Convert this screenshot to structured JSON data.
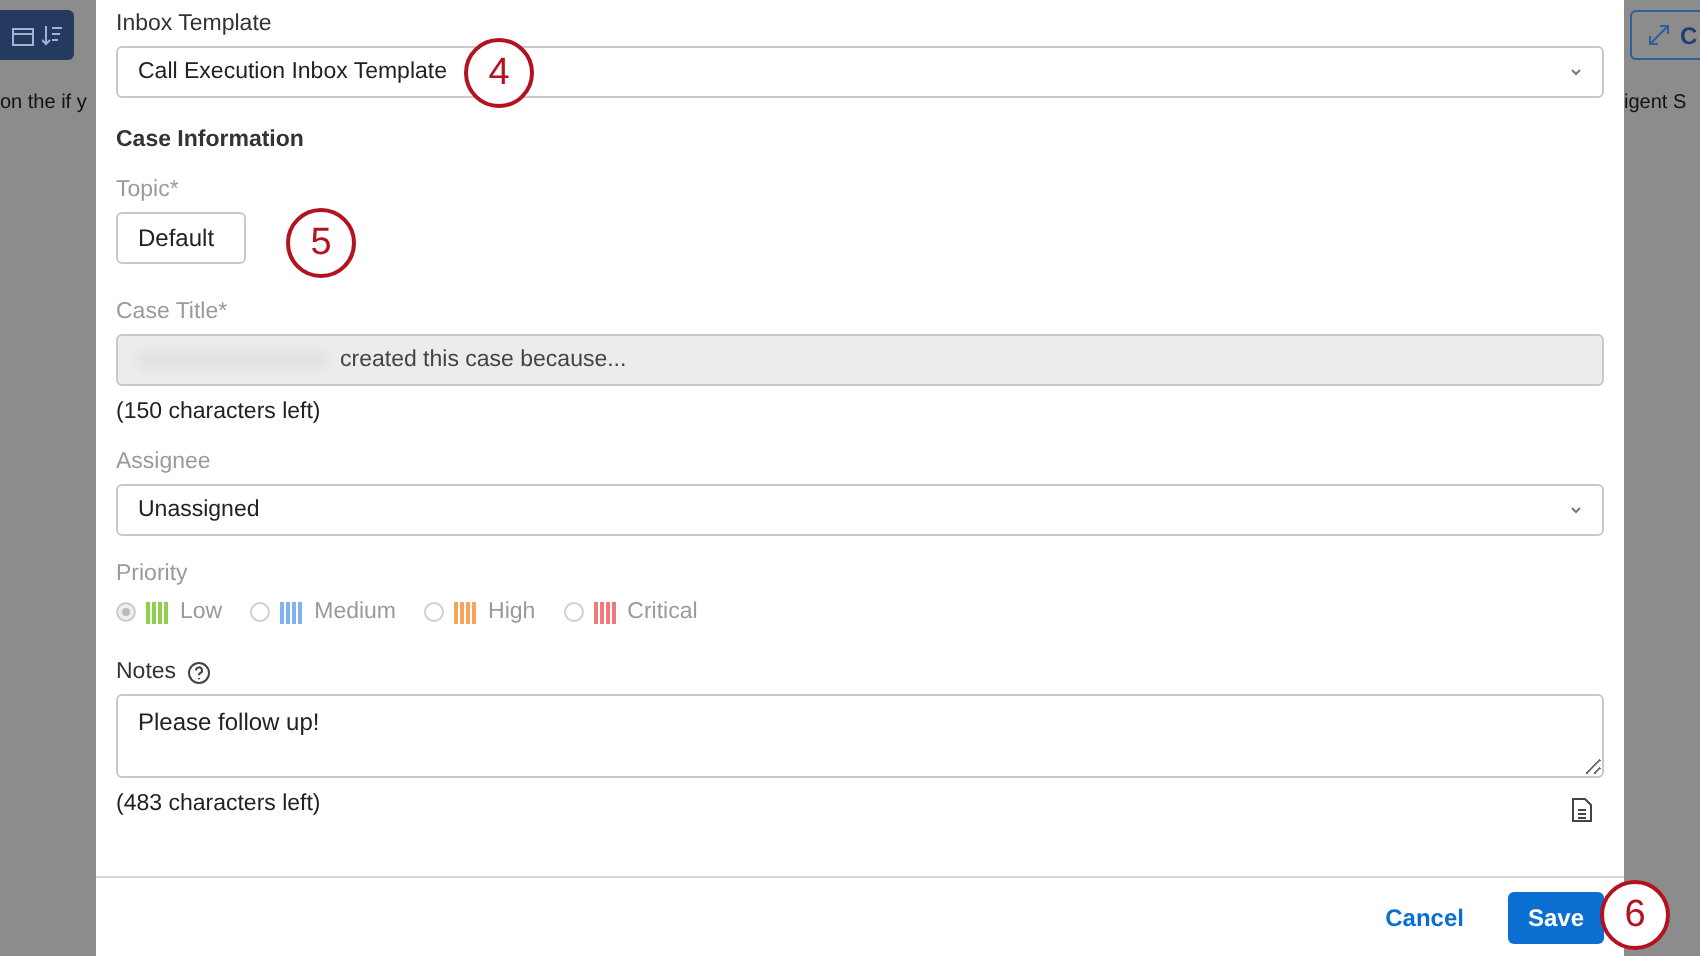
{
  "background": {
    "left_text": "on the if y",
    "right_button_label": "C",
    "right_text": "igent S"
  },
  "dialog": {
    "inbox_template": {
      "label": "Inbox Template",
      "value": "Call Execution Inbox Template"
    },
    "section_title": "Case Information",
    "topic": {
      "label": "Topic*",
      "value": "Default",
      "disabled": true
    },
    "case_title": {
      "label": "Case Title*",
      "value": "created this case because...",
      "disabled": true,
      "counter": "(150 characters left)"
    },
    "assignee": {
      "label": "Assignee",
      "value": "Unassigned"
    },
    "priority": {
      "label": "Priority",
      "disabled": true,
      "options": [
        {
          "label": "Low",
          "color": "#8fd14f",
          "selected": true
        },
        {
          "label": "Medium",
          "color": "#7fb2f0",
          "selected": false
        },
        {
          "label": "High",
          "color": "#f5a55a",
          "selected": false
        },
        {
          "label": "Critical",
          "color": "#f07a7a",
          "selected": false
        }
      ]
    },
    "notes": {
      "label": "Notes",
      "value": "Please follow up!",
      "counter": "(483 characters left)"
    },
    "buttons": [
      {
        "label": "Cancel",
        "kind": "link"
      },
      {
        "label": "Save",
        "kind": "primary"
      }
    ]
  },
  "callouts": [
    {
      "label": "4"
    },
    {
      "label": "5"
    },
    {
      "label": "6"
    }
  ]
}
